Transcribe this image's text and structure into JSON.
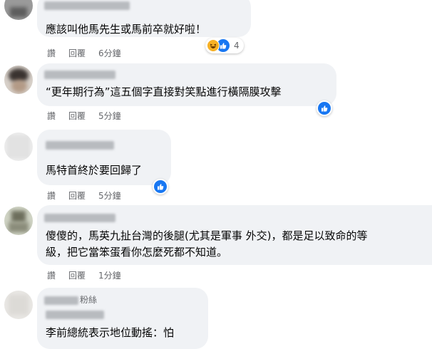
{
  "actions": {
    "like": "讚",
    "reply": "回覆"
  },
  "comments": [
    {
      "text": "應該叫他馬先生或馬前卒就好啦！",
      "time": "6分鐘",
      "reaction_count": "4",
      "reactions": [
        "haha-icon",
        "like-icon"
      ]
    },
    {
      "text": "“更年期行為”這五個字直接對笑點進行橫隔膜攻擊",
      "time": "5分鐘",
      "reactions": [
        "like-icon"
      ]
    },
    {
      "text": "馬特首終於要回歸了",
      "time": "5分鐘",
      "reactions": [
        "like-icon"
      ]
    },
    {
      "text_line1": "傻傻的，馬英九扯台灣的後腿(尤其是軍事 外交)，都是足以致命的等",
      "text_line2": "級，把它當笨蛋看你怎麼死都不知道。",
      "time": "1分鐘"
    },
    {
      "badge": "粉絲",
      "text": "李前總統表示地位動搖：怕"
    }
  ],
  "colors": {
    "like_blue": "#1877f2",
    "bubble_bg": "#f0f2f5",
    "meta_gray": "#65676b"
  }
}
